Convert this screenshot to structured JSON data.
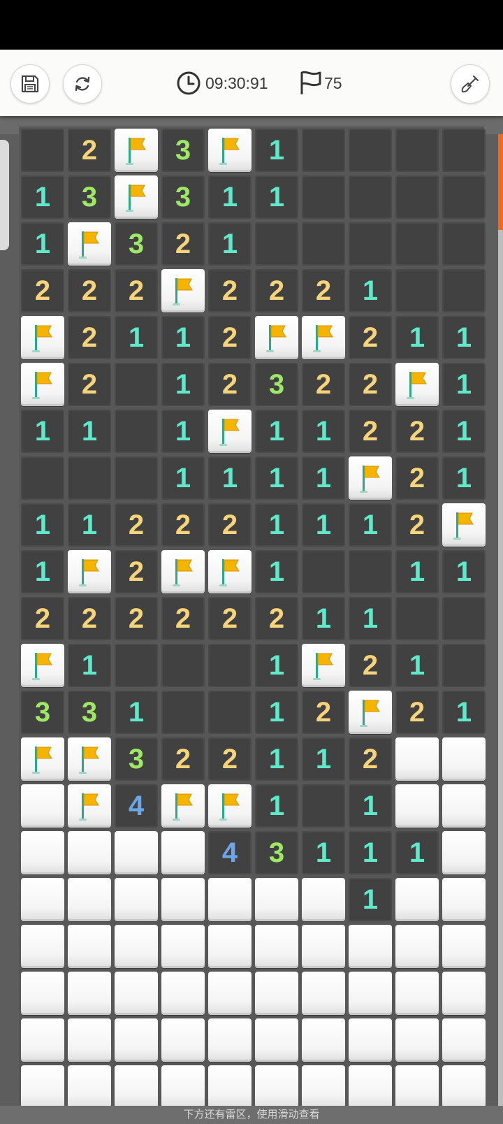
{
  "toolbar": {
    "save_icon": "save-icon",
    "restart_icon": "restart-icon",
    "clock_icon": "clock-icon",
    "timer": "09:30:91",
    "flag_icon": "flag-outline-icon",
    "flags_count": "75",
    "shovel_icon": "shovel-icon"
  },
  "board": {
    "columns": 10,
    "rows": [
      [
        "o",
        "2",
        "F",
        "3",
        "F",
        "1",
        "o",
        "o",
        "o",
        "o"
      ],
      [
        "1",
        "3",
        "F",
        "3",
        "1",
        "1",
        "o",
        "o",
        "o",
        "o"
      ],
      [
        "1",
        "F",
        "3",
        "2",
        "1",
        "o",
        "o",
        "o",
        "o",
        "o"
      ],
      [
        "2",
        "2",
        "2",
        "F",
        "2",
        "2",
        "2",
        "1",
        "o",
        "o"
      ],
      [
        "F",
        "2",
        "1",
        "1",
        "2",
        "F",
        "F",
        "2",
        "1",
        "1"
      ],
      [
        "F",
        "2",
        "o",
        "1",
        "2",
        "3",
        "2",
        "2",
        "F",
        "1"
      ],
      [
        "1",
        "1",
        "o",
        "1",
        "F",
        "1",
        "1",
        "2",
        "2",
        "1"
      ],
      [
        "o",
        "o",
        "o",
        "1",
        "1",
        "1",
        "1",
        "F",
        "2",
        "1"
      ],
      [
        "1",
        "1",
        "2",
        "2",
        "2",
        "1",
        "1",
        "1",
        "2",
        "F"
      ],
      [
        "1",
        "F",
        "2",
        "F",
        "F",
        "1",
        "o",
        "o",
        "1",
        "1"
      ],
      [
        "2",
        "2",
        "2",
        "2",
        "2",
        "2",
        "1",
        "1",
        "o",
        "o"
      ],
      [
        "F",
        "1",
        "o",
        "o",
        "o",
        "1",
        "F",
        "2",
        "1",
        "o"
      ],
      [
        "3",
        "3",
        "1",
        "o",
        "o",
        "1",
        "2",
        "F",
        "2",
        "1"
      ],
      [
        "F",
        "F",
        "3",
        "2",
        "2",
        "1",
        "1",
        "2",
        "H",
        "H"
      ],
      [
        "H",
        "F",
        "4",
        "F",
        "F",
        "1",
        "o",
        "1",
        "H",
        "H"
      ],
      [
        "H",
        "H",
        "H",
        "H",
        "4",
        "3",
        "1",
        "1",
        "1",
        "H"
      ],
      [
        "H",
        "H",
        "H",
        "H",
        "H",
        "H",
        "H",
        "1",
        "H",
        "H"
      ],
      [
        "H",
        "H",
        "H",
        "H",
        "H",
        "H",
        "H",
        "H",
        "H",
        "H"
      ],
      [
        "H",
        "H",
        "H",
        "H",
        "H",
        "H",
        "H",
        "H",
        "H",
        "H"
      ],
      [
        "H",
        "H",
        "H",
        "H",
        "H",
        "H",
        "H",
        "H",
        "H",
        "H"
      ],
      [
        "H",
        "H",
        "H",
        "H",
        "H",
        "H",
        "H",
        "H",
        "H",
        "H"
      ]
    ]
  },
  "bottom_hint": "下方还有雷区，使用滑动查看",
  "colors": {
    "num1": "#5fe8c9",
    "num2": "#f6d47c",
    "num3": "#9de864",
    "num4": "#6aa6ea",
    "flag": "#f5b400",
    "scroll_thumb": "#f0691c"
  }
}
